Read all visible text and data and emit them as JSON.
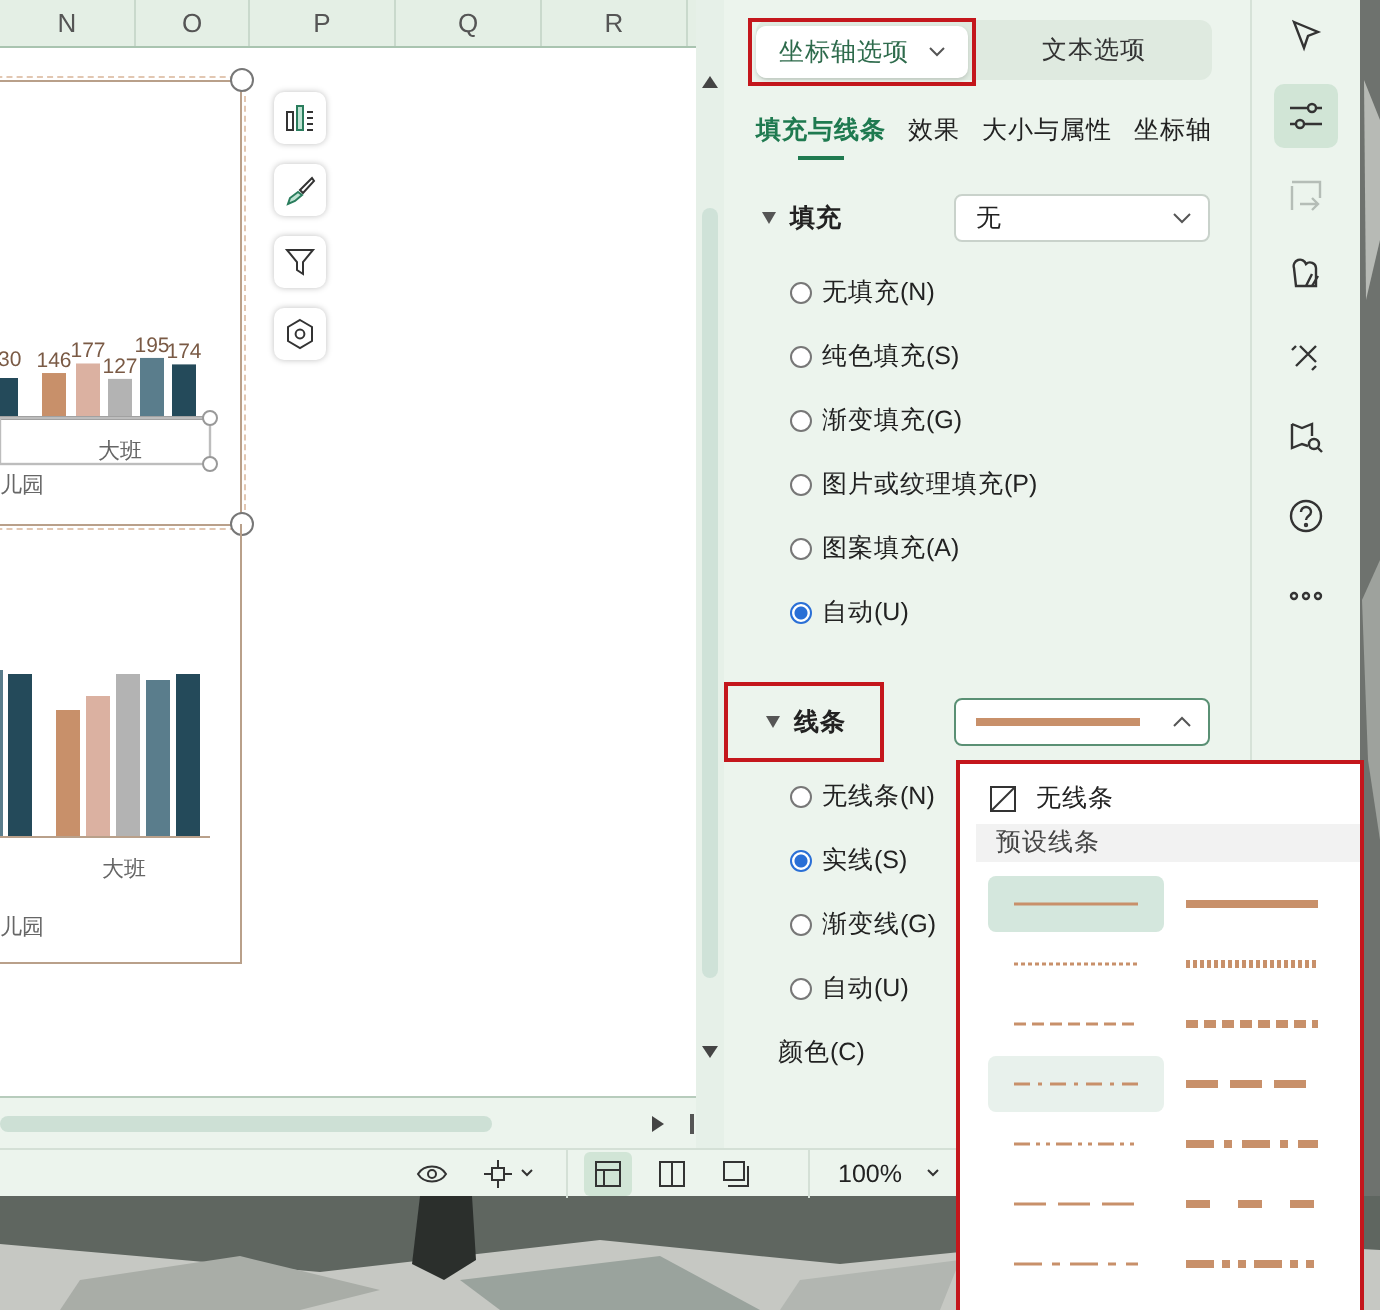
{
  "sheet": {
    "columns": [
      "N",
      "O",
      "P",
      "Q",
      "R"
    ],
    "charts": [
      {
        "cut_bar_label": "30",
        "group": "儿园",
        "selected": true,
        "chart_data": {
          "type": "bar",
          "categories": [
            "大班"
          ],
          "series": [
            {
              "color": "#c8906a",
              "values": [
                146
              ]
            },
            {
              "color": "#dbb1a1",
              "values": [
                177
              ]
            },
            {
              "color": "#b3b3b3",
              "values": [
                127
              ]
            },
            {
              "color": "#5a7d8c",
              "values": [
                195
              ]
            },
            {
              "color": "#244a5a",
              "values": [
                174
              ]
            }
          ],
          "data_labels": true
        }
      },
      {
        "category": "大班",
        "group": "儿园",
        "selected": false
      }
    ],
    "chart_tools": [
      {
        "kind": "elements"
      },
      {
        "kind": "style"
      },
      {
        "kind": "filter"
      },
      {
        "kind": "settings"
      }
    ]
  },
  "task_pane": {
    "option_tabs": [
      {
        "label": "坐标轴选项",
        "selected": true,
        "annotated": true,
        "has_menu": true
      },
      {
        "label": "文本选项",
        "selected": false,
        "annotated": false,
        "has_menu": false
      }
    ],
    "sub_tabs": [
      {
        "label": "填充与线条",
        "selected": true
      },
      {
        "label": "效果",
        "selected": false
      },
      {
        "label": "大小与属性",
        "selected": false
      },
      {
        "label": "坐标轴",
        "selected": false
      }
    ],
    "sections": [
      {
        "title": "填充",
        "expanded": true,
        "annotated": false,
        "picker": {
          "kind": "text",
          "value": "无",
          "open": false
        },
        "options": [
          {
            "label": "无填充(N)",
            "selected": false
          },
          {
            "label": "纯色填充(S)",
            "selected": false
          },
          {
            "label": "渐变填充(G)",
            "selected": false
          },
          {
            "label": "图片或纹理填充(P)",
            "selected": false
          },
          {
            "label": "图案填充(A)",
            "selected": false
          },
          {
            "label": "自动(U)",
            "selected": true
          }
        ]
      },
      {
        "title": "线条",
        "expanded": true,
        "annotated": true,
        "picker": {
          "kind": "line",
          "open": true
        },
        "options": [
          {
            "label": "无线条(N)",
            "selected": false
          },
          {
            "label": "实线(S)",
            "selected": true
          },
          {
            "label": "渐变线(G)",
            "selected": false
          },
          {
            "label": "自动(U)",
            "selected": false
          }
        ],
        "fields": [
          {
            "label": "颜色(C)"
          }
        ]
      }
    ]
  },
  "side_rail": [
    {
      "kind": "pointer",
      "selected": false,
      "disabled": false
    },
    {
      "kind": "properties",
      "selected": true,
      "disabled": false
    },
    {
      "kind": "crop",
      "selected": false,
      "disabled": true
    },
    {
      "kind": "chart-style",
      "selected": false,
      "disabled": false
    },
    {
      "kind": "tools",
      "selected": false,
      "disabled": false
    },
    {
      "kind": "book-search",
      "selected": false,
      "disabled": false
    },
    {
      "kind": "help",
      "selected": false,
      "disabled": false
    },
    {
      "kind": "more",
      "selected": false,
      "disabled": false
    }
  ],
  "status_bar": {
    "zoom": "100%",
    "views": [
      {
        "kind": "normal",
        "selected": true
      },
      {
        "kind": "split",
        "selected": false
      },
      {
        "kind": "page",
        "selected": false
      }
    ]
  },
  "line_menu": {
    "annotated": true,
    "none_label": "无线条",
    "group_title": "预设线条",
    "presets": [
      {
        "kind": "solid",
        "thick": false,
        "selected": true,
        "hovered": false
      },
      {
        "kind": "solid",
        "thick": true,
        "selected": false,
        "hovered": false
      },
      {
        "kind": "dot",
        "thick": false,
        "selected": false,
        "hovered": false
      },
      {
        "kind": "dot",
        "thick": true,
        "selected": false,
        "hovered": false
      },
      {
        "kind": "dash",
        "thick": false,
        "selected": false,
        "hovered": false
      },
      {
        "kind": "dash",
        "thick": true,
        "selected": false,
        "hovered": false
      },
      {
        "kind": "dashdot",
        "thick": false,
        "selected": false,
        "hovered": true
      },
      {
        "kind": "longdash",
        "thick": true,
        "selected": false,
        "hovered": false
      },
      {
        "kind": "dashdotdot",
        "thick": false,
        "selected": false,
        "hovered": false
      },
      {
        "kind": "longdashdot",
        "thick": true,
        "selected": false,
        "hovered": false
      },
      {
        "kind": "longdash",
        "thick": false,
        "selected": false,
        "hovered": false
      },
      {
        "kind": "longgap",
        "thick": true,
        "selected": false,
        "hovered": false
      },
      {
        "kind": "longdashdot",
        "thick": false,
        "selected": false,
        "hovered": false
      },
      {
        "kind": "longdashdotdot",
        "thick": true,
        "selected": false,
        "hovered": false
      }
    ]
  }
}
